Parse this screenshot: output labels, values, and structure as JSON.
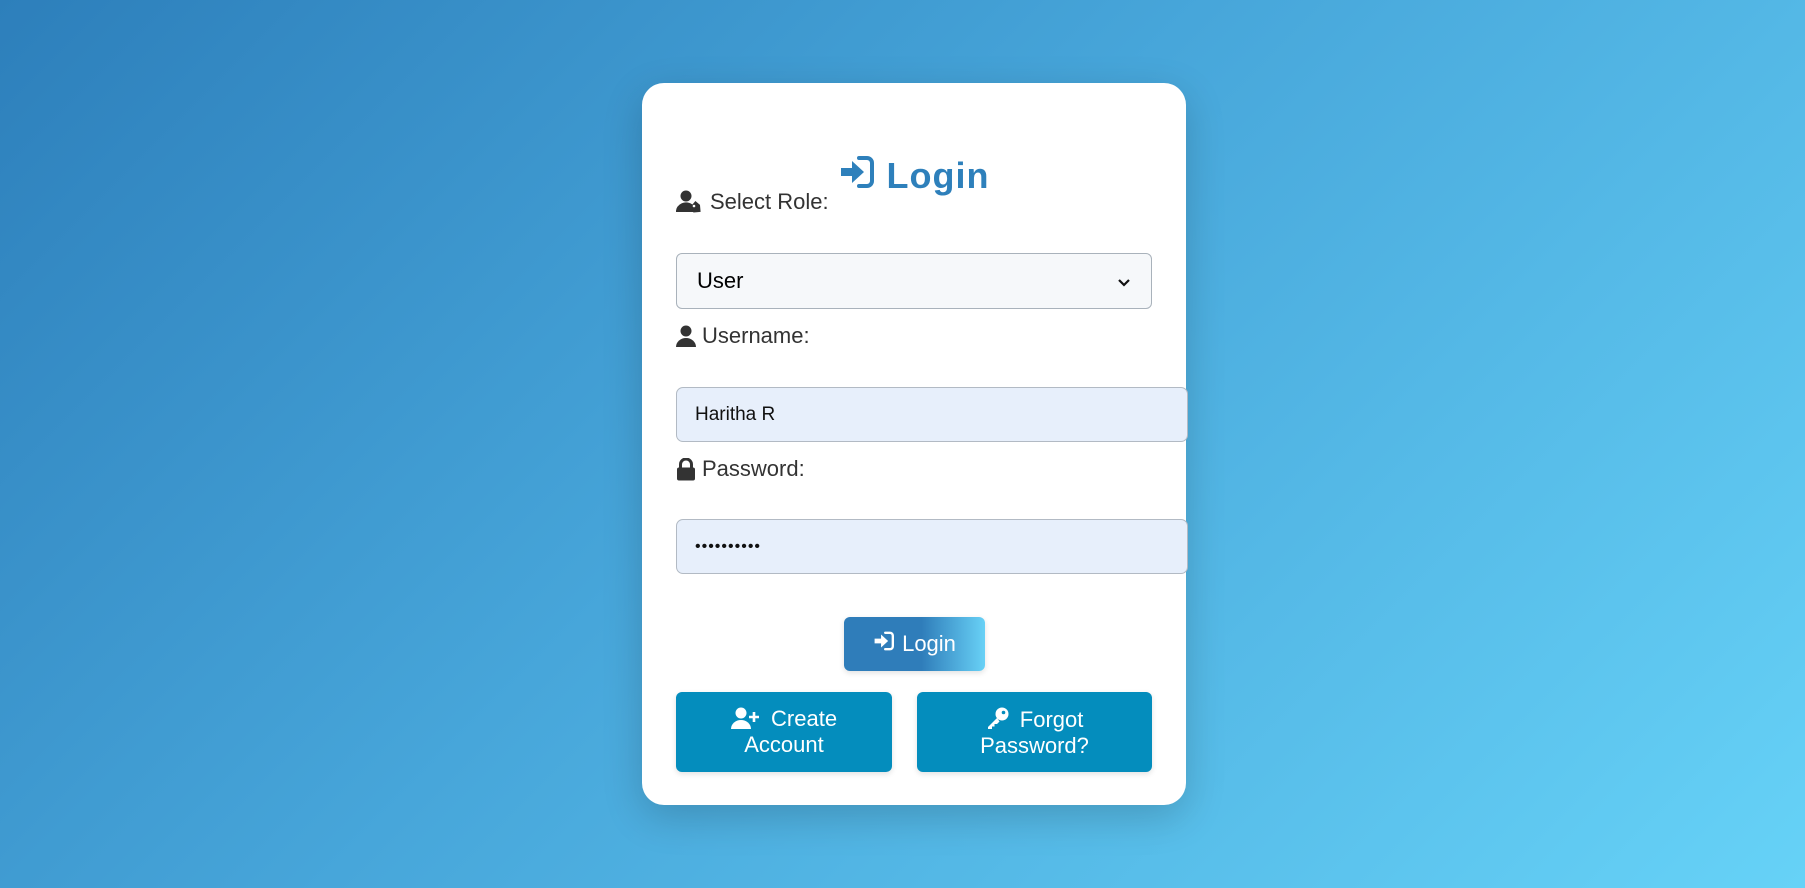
{
  "login_card": {
    "title": "Login",
    "title_icon": "sign-in-icon",
    "role": {
      "label": "Select Role:",
      "icon": "user-tag-icon",
      "selected": "User"
    },
    "username": {
      "label": "Username:",
      "icon": "user-icon",
      "value": "Haritha R"
    },
    "password": {
      "label": "Password:",
      "icon": "lock-icon",
      "masked_value": "••••••••••"
    },
    "login_button": {
      "label": "Login",
      "icon": "sign-in-icon"
    },
    "create_account_button": {
      "line1": "Create",
      "line2": "Account",
      "icon": "user-plus-icon"
    },
    "forgot_password_button": {
      "line1": "Forgot",
      "line2": "Password?",
      "icon": "key-icon"
    }
  },
  "colors": {
    "background_start": "#2d7fbb",
    "background_end": "#66d2f7",
    "title": "#2e80bb",
    "action_button": "#048dbd",
    "input_fill": "#e7effb"
  }
}
